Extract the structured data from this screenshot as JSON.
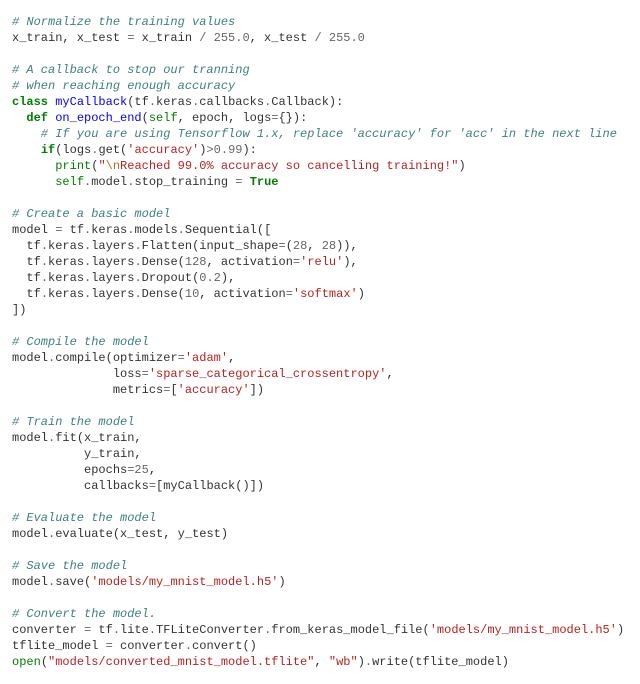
{
  "code": {
    "c1": "# Normalize the training values",
    "l2a": "x_train, x_test ",
    "l2b": "=",
    "l2c": " x_train ",
    "l2d": "/",
    "l2e": " ",
    "l2f": "255.0",
    "l2g": ", x_test ",
    "l2h": "/",
    "l2i": " ",
    "l2j": "255.0",
    "c3": "# A callback to stop our tranning",
    "c4": "# when reaching enough accuracy",
    "l5a": "class",
    "l5b": " ",
    "l5c": "myCallback",
    "l5d": "(tf",
    "l5e": ".",
    "l5f": "keras",
    "l5g": ".",
    "l5h": "callbacks",
    "l5i": ".",
    "l5j": "Callback):",
    "l6a": "  ",
    "l6b": "def",
    "l6c": " ",
    "l6d": "on_epoch_end",
    "l6e": "(",
    "l6f": "self",
    "l6g": ", epoch, logs",
    "l6h": "=",
    "l6i": "{}):",
    "c7": "    # If you are using Tensorflow 1.x, replace 'accuracy' for 'acc' in the next line",
    "l8a": "    ",
    "l8b": "if",
    "l8c": "(logs",
    "l8d": ".",
    "l8e": "get(",
    "l8f": "'accuracy'",
    "l8g": ")",
    "l8h": ">",
    "l8i": "0.99",
    "l8j": "):",
    "l9a": "      ",
    "l9b": "print",
    "l9c": "(",
    "l9d": "\"",
    "l9e": "\\n",
    "l9f": "Reached 99.0% accuracy so cancelling training!\"",
    "l9g": ")",
    "l10a": "      ",
    "l10b": "self",
    "l10c": ".",
    "l10d": "model",
    "l10e": ".",
    "l10f": "stop_training ",
    "l10g": "=",
    "l10h": " ",
    "l10i": "True",
    "c11": "# Create a basic model",
    "l12a": "model ",
    "l12b": "=",
    "l12c": " tf",
    "l12d": ".",
    "l12e": "keras",
    "l12f": ".",
    "l12g": "models",
    "l12h": ".",
    "l12i": "Sequential([",
    "l13a": "  tf",
    "l13b": ".",
    "l13c": "keras",
    "l13d": ".",
    "l13e": "layers",
    "l13f": ".",
    "l13g": "Flatten(input_shape",
    "l13h": "=",
    "l13i": "(",
    "l13j": "28",
    "l13k": ", ",
    "l13l": "28",
    "l13m": ")),",
    "l14a": "  tf",
    "l14b": ".",
    "l14c": "keras",
    "l14d": ".",
    "l14e": "layers",
    "l14f": ".",
    "l14g": "Dense(",
    "l14h": "128",
    "l14i": ", activation",
    "l14j": "=",
    "l14k": "'relu'",
    "l14l": "),",
    "l15a": "  tf",
    "l15b": ".",
    "l15c": "keras",
    "l15d": ".",
    "l15e": "layers",
    "l15f": ".",
    "l15g": "Dropout(",
    "l15h": "0.2",
    "l15i": "),",
    "l16a": "  tf",
    "l16b": ".",
    "l16c": "keras",
    "l16d": ".",
    "l16e": "layers",
    "l16f": ".",
    "l16g": "Dense(",
    "l16h": "10",
    "l16i": ", activation",
    "l16j": "=",
    "l16k": "'softmax'",
    "l16l": ")",
    "l17": "])",
    "c18": "# Compile the model",
    "l19a": "model",
    "l19b": ".",
    "l19c": "compile(optimizer",
    "l19d": "=",
    "l19e": "'adam'",
    "l19f": ",",
    "l20a": "              loss",
    "l20b": "=",
    "l20c": "'sparse_categorical_crossentropy'",
    "l20d": ",",
    "l21a": "              metrics",
    "l21b": "=",
    "l21c": "[",
    "l21d": "'accuracy'",
    "l21e": "])",
    "c22": "# Train the model",
    "l23a": "model",
    "l23b": ".",
    "l23c": "fit(x_train,",
    "l24": "          y_train,",
    "l25a": "          epochs",
    "l25b": "=",
    "l25c": "25",
    "l25d": ",",
    "l26a": "          callbacks",
    "l26b": "=",
    "l26c": "[myCallback()])",
    "c27": "# Evaluate the model",
    "l28a": "model",
    "l28b": ".",
    "l28c": "evaluate(x_test, y_test)",
    "c29": "# Save the model",
    "l30a": "model",
    "l30b": ".",
    "l30c": "save(",
    "l30d": "'models/my_mnist_model.h5'",
    "l30e": ")",
    "c31": "# Convert the model.",
    "l32a": "converter ",
    "l32b": "=",
    "l32c": " tf",
    "l32d": ".",
    "l32e": "lite",
    "l32f": ".",
    "l32g": "TFLiteConverter",
    "l32h": ".",
    "l32i": "from_keras_model_file(",
    "l32j": "'models/my_mnist_model.h5'",
    "l32k": ")",
    "l33a": "tflite_model ",
    "l33b": "=",
    "l33c": " converter",
    "l33d": ".",
    "l33e": "convert()",
    "l34a": "open",
    "l34b": "(",
    "l34c": "\"models/converted_mnist_model.tflite\"",
    "l34d": ", ",
    "l34e": "\"wb\"",
    "l34f": ")",
    "l34g": ".",
    "l34h": "write(tflite_model)"
  }
}
